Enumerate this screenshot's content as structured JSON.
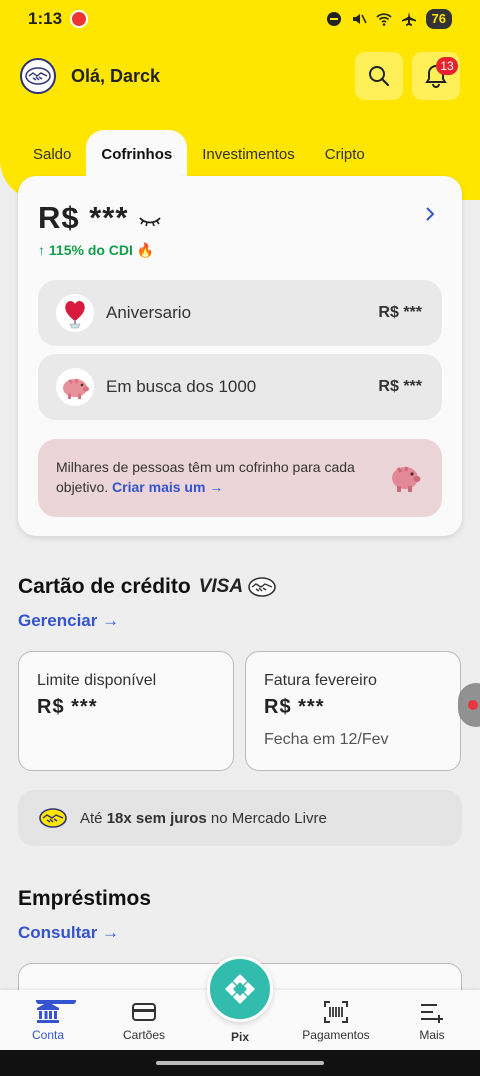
{
  "status_bar": {
    "time": "1:13",
    "battery": "76"
  },
  "header": {
    "greeting": "Olá, Darck",
    "notifications_count": "13"
  },
  "tabs": [
    {
      "label": "Saldo",
      "active": false
    },
    {
      "label": "Cofrinhos",
      "active": true
    },
    {
      "label": "Investimentos",
      "active": false
    },
    {
      "label": "Cripto",
      "active": false
    }
  ],
  "cofrinhos": {
    "balance": "R$ ***",
    "yield": "↑ 115% do CDI 🔥",
    "items": [
      {
        "name": "Aniversario",
        "amount": "R$ ***",
        "icon": "heart-balloon-icon"
      },
      {
        "name": "Em busca dos 1000",
        "amount": "R$ ***",
        "icon": "piggy-bank-icon"
      }
    ],
    "promo_text": "Milhares de pessoas têm um cofrinho para cada objetivo.",
    "promo_link": "Criar mais um →"
  },
  "credit_card": {
    "title": "Cartão de crédito",
    "brand": "VISA",
    "manage_link": "Gerenciar →",
    "limit_label": "Limite disponível",
    "limit_value": "R$ ***",
    "invoice_label": "Fatura fevereiro",
    "invoice_value": "R$ ***",
    "invoice_close": "Fecha em 12/Fev",
    "installments_prefix": "Até",
    "installments_bold": "18x sem juros",
    "installments_suffix": "no Mercado Livre"
  },
  "loans": {
    "title": "Empréstimos",
    "link": "Consultar →"
  },
  "bottom_nav": {
    "items": [
      {
        "label": "Conta",
        "icon": "bank-icon",
        "active": true
      },
      {
        "label": "Cartões",
        "icon": "card-icon",
        "active": false
      },
      {
        "label": "Pix",
        "icon": "pix-icon",
        "active": false
      },
      {
        "label": "Pagamentos",
        "icon": "barcode-icon",
        "active": false
      },
      {
        "label": "Mais",
        "icon": "menu-plus-icon",
        "active": false
      }
    ]
  },
  "colors": {
    "brand_yellow": "#ffe600",
    "link_blue": "#3454d1",
    "yield_green": "#149e4b",
    "pix_teal": "#32bcad"
  }
}
